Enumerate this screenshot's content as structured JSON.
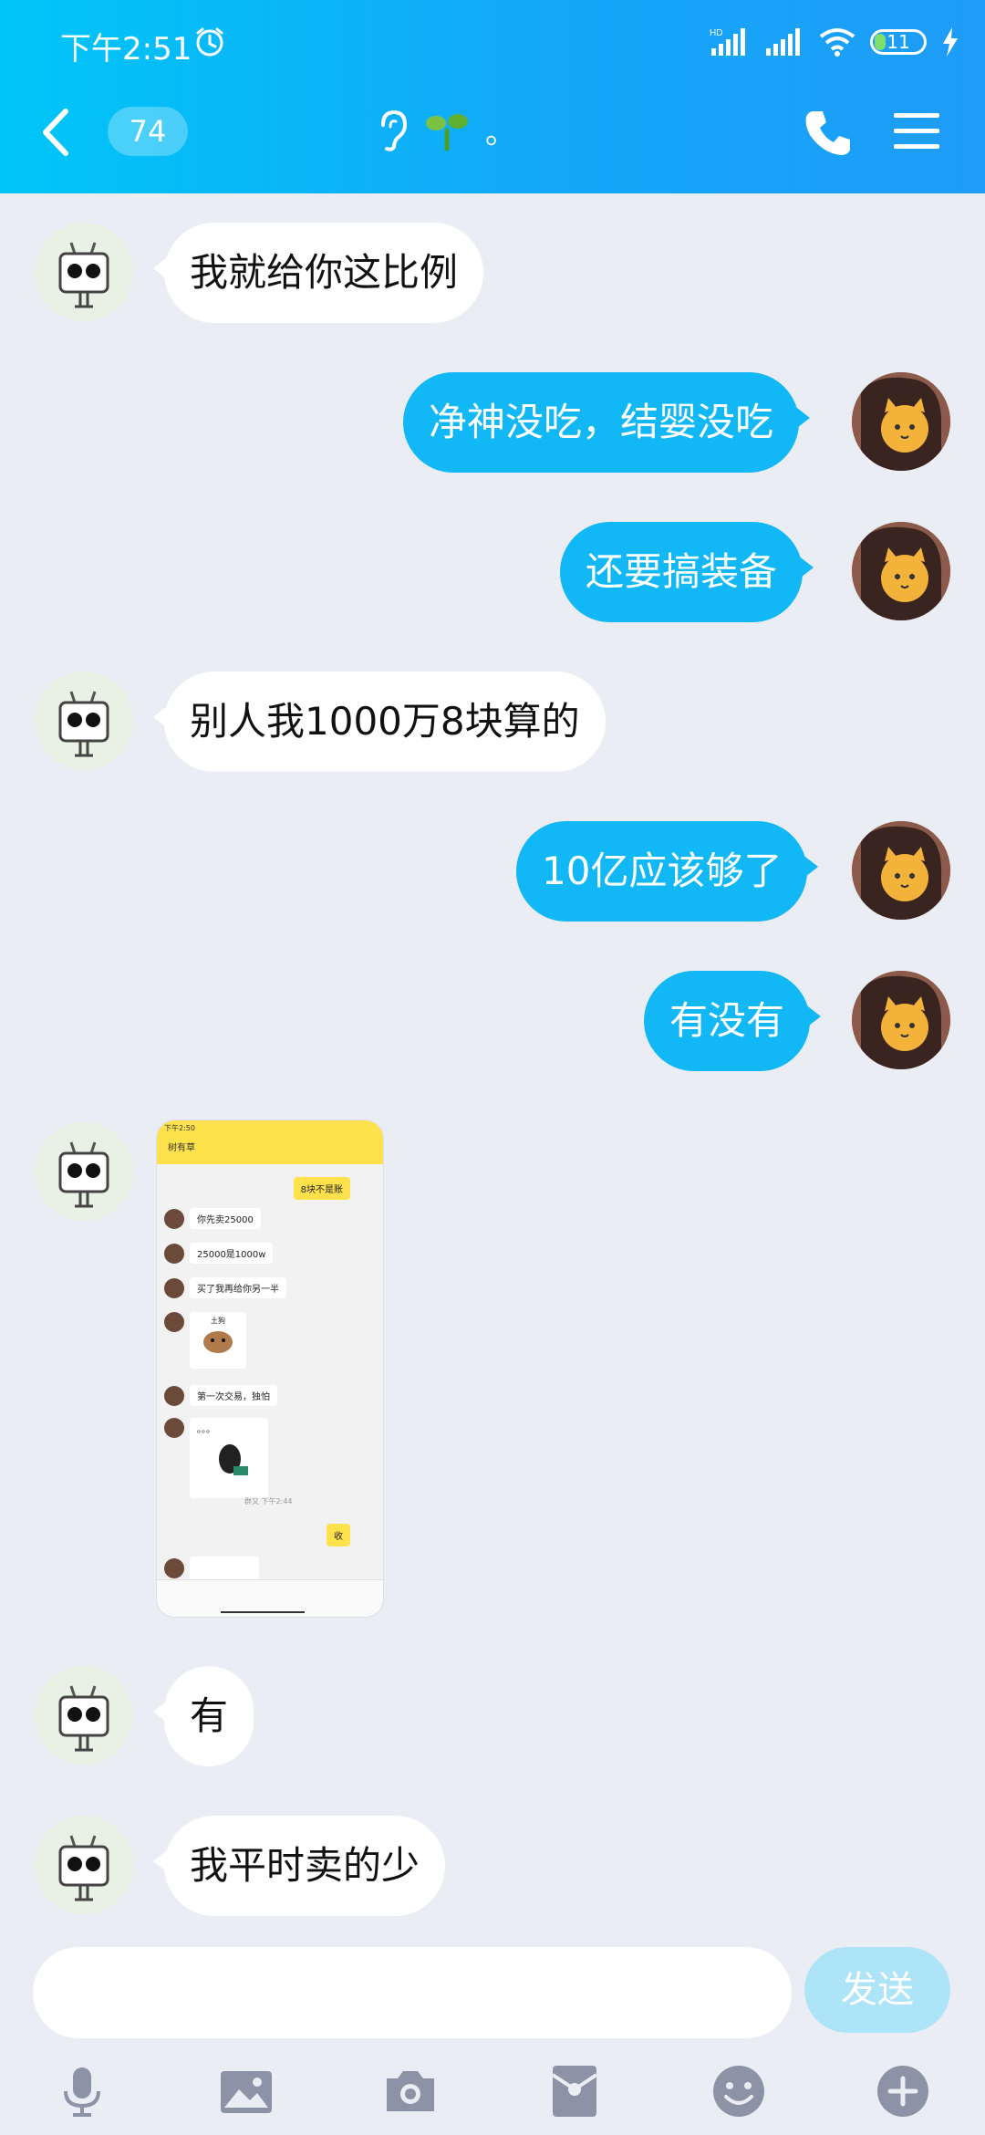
{
  "status": {
    "time": "下午2:51",
    "network": "HD",
    "battery": "11"
  },
  "header": {
    "unread": "74",
    "title_suffix": "。"
  },
  "messages": [
    {
      "side": "in",
      "text": "我就给你这比例"
    },
    {
      "side": "out",
      "text": "净神没吃，结婴没吃"
    },
    {
      "side": "out",
      "text": "还要搞装备"
    },
    {
      "side": "in",
      "text": "别人我1000万8块算的"
    },
    {
      "side": "out",
      "text": "10亿应该够了"
    },
    {
      "side": "out",
      "text": "有没有"
    },
    {
      "side": "in",
      "type": "image",
      "text": ""
    },
    {
      "side": "in",
      "text": "有"
    },
    {
      "side": "in",
      "text": "我平时卖的少"
    }
  ],
  "screenshot": {
    "time": "下午2:50",
    "name": "树有草",
    "msg_top": "8块不是账",
    "lines": [
      "你先卖25000",
      "25000是1000w",
      "买了我再给你另一半"
    ],
    "sticker_label": "土狗",
    "line4": "第一次交易，独怕",
    "dots": "。。。",
    "note": "群又 下午2:44",
    "reply": "收"
  },
  "input": {
    "placeholder": "",
    "send_label": "发送"
  },
  "toolbar": [
    "mic-icon",
    "image-icon",
    "camera-icon",
    "redpacket-icon",
    "emoji-icon",
    "plus-icon"
  ]
}
